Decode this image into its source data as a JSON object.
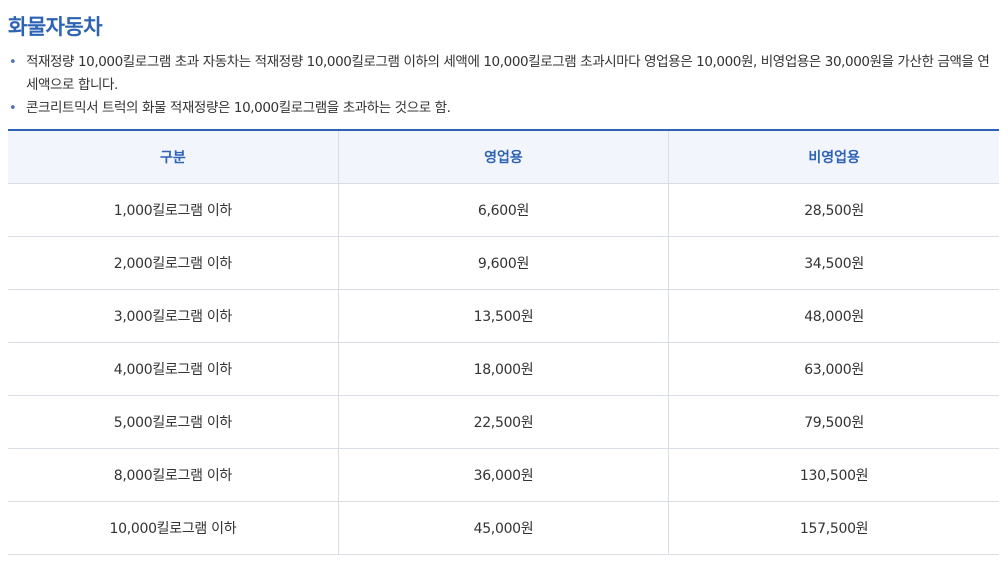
{
  "title": "화물자동차",
  "notes": [
    "적재정량 10,000킬로그램 초과 자동차는 적재정량 10,000킬로그램 이하의 세액에 10,000킬로그램 초과시마다 영업용은 10,000원, 비영업용은 30,000원을 가산한 금액을 연세액으로 합니다.",
    "콘크리트믹서 트럭의 화물 적재정량은 10,000킬로그램을 초과하는 것으로 함."
  ],
  "table": {
    "headers": [
      "구분",
      "영업용",
      "비영업용"
    ],
    "rows": [
      [
        "1,000킬로그램 이하",
        "6,600원",
        "28,500원"
      ],
      [
        "2,000킬로그램 이하",
        "9,600원",
        "34,500원"
      ],
      [
        "3,000킬로그램 이하",
        "13,500원",
        "48,000원"
      ],
      [
        "4,000킬로그램 이하",
        "18,000원",
        "63,000원"
      ],
      [
        "5,000킬로그램 이하",
        "22,500원",
        "79,500원"
      ],
      [
        "8,000킬로그램 이하",
        "36,000원",
        "130,500원"
      ],
      [
        "10,000킬로그램 이하",
        "45,000원",
        "157,500원"
      ]
    ]
  }
}
